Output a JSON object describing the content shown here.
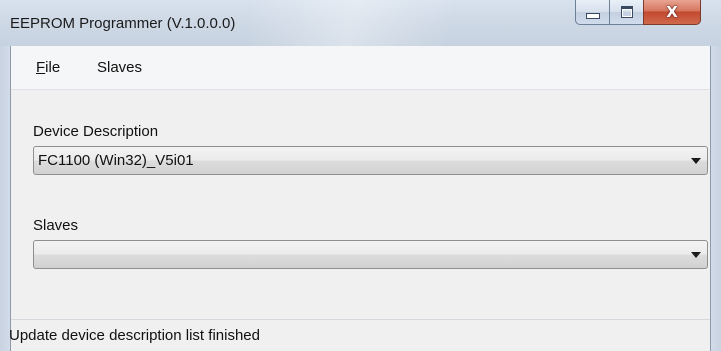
{
  "window": {
    "title": "EEPROM Programmer (V.1.0.0.0)",
    "caption_buttons": {
      "minimize_icon": "minimize-icon",
      "maximize_icon": "maximize-icon",
      "close_icon": "close-icon",
      "close_glyph": "X"
    }
  },
  "menu": {
    "file_mnemonic": "F",
    "file_rest": "ile",
    "slaves": "Slaves"
  },
  "form": {
    "device_description_label": "Device Description",
    "device_description_value": "FC1100 (Win32)_V5i01",
    "slaves_label": "Slaves",
    "slaves_value": ""
  },
  "status": {
    "text": "Update device description list finished"
  },
  "colors": {
    "titlebar": "#cfd9e6",
    "close_button": "#c24a30",
    "client_background": "#f0f0f0"
  }
}
